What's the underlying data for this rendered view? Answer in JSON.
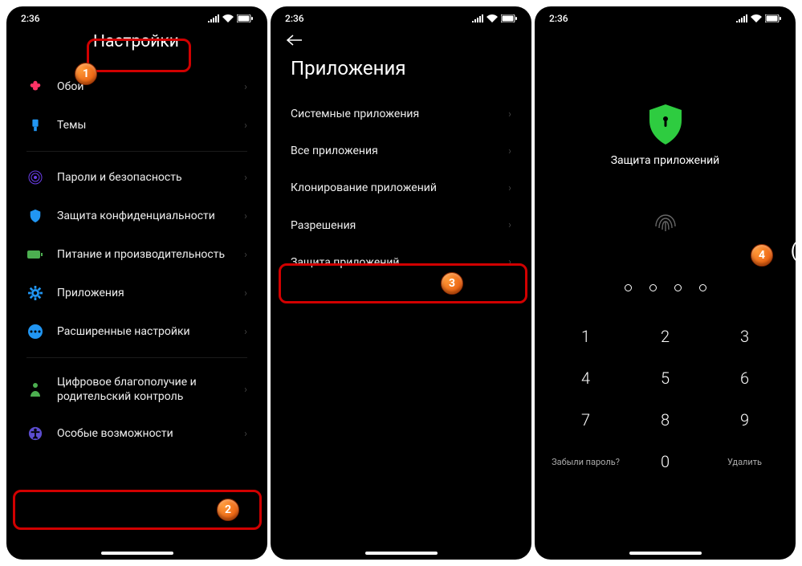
{
  "status_time": "2:36",
  "panel1": {
    "title": "Настройки",
    "items": [
      {
        "label": "Обои",
        "icon": "flower",
        "color": "#ff3366"
      },
      {
        "label": "Темы",
        "icon": "brush",
        "color": "#2196f3"
      },
      {
        "divider": true
      },
      {
        "label": "Пароли и безопасность",
        "icon": "finger",
        "color": "#6a3de8"
      },
      {
        "label": "Защита конфиденциальности",
        "icon": "shield3d",
        "color": "#2196f3"
      },
      {
        "label": "Питание и производительность",
        "icon": "battery",
        "color": "#4caf50"
      },
      {
        "label": "Приложения",
        "icon": "gear",
        "color": "#2196f3"
      },
      {
        "label": "Расширенные настройки",
        "icon": "dots",
        "color": "#2196f3"
      },
      {
        "divider": true
      },
      {
        "label": "Цифровое благополучие и родительский контроль",
        "icon": "person",
        "color": "#4caf50"
      },
      {
        "label": "Особые возможности",
        "icon": "access",
        "color": "#5b4cce"
      }
    ]
  },
  "panel2": {
    "title": "Приложения",
    "items": [
      {
        "label": "Системные приложения"
      },
      {
        "label": "Все приложения"
      },
      {
        "label": "Клонирование приложений"
      },
      {
        "label": "Разрешения"
      },
      {
        "label": "Защита приложений"
      }
    ]
  },
  "panel3": {
    "title": "Защита приложений",
    "keypad": [
      "1",
      "2",
      "3",
      "4",
      "5",
      "6",
      "7",
      "8",
      "9"
    ],
    "zero": "0",
    "forgot": "Забыли пароль?",
    "delete": "Удалить"
  },
  "annotations": [
    "1",
    "2",
    "3",
    "4"
  ]
}
